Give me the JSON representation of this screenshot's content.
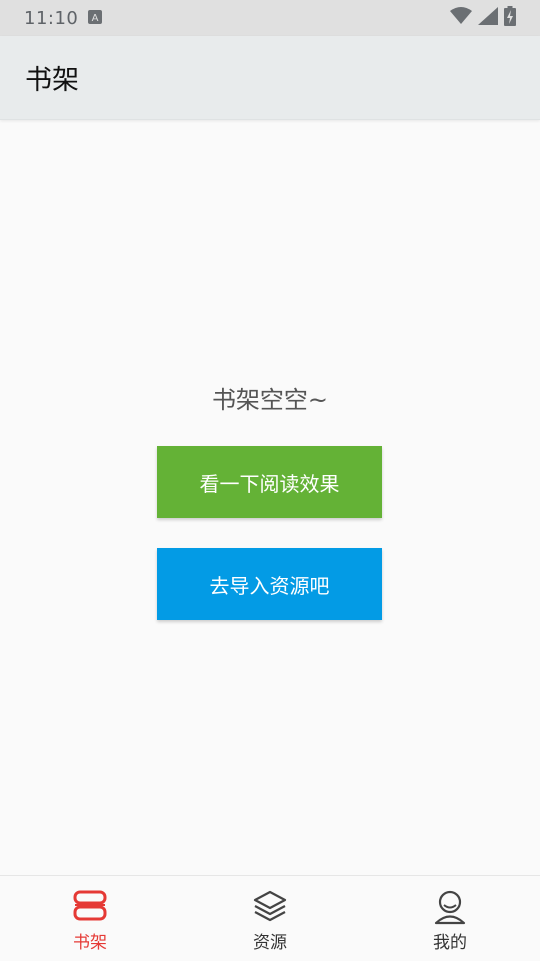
{
  "status_bar": {
    "time": "11:10",
    "notification_icon": "a-box-icon",
    "icons": [
      "wifi-icon",
      "signal-icon",
      "battery-charging-icon"
    ]
  },
  "app_bar": {
    "title": "书架"
  },
  "empty_state": {
    "message": "书架空空~",
    "demo_button_label": "看一下阅读效果",
    "import_button_label": "去导入资源吧"
  },
  "bottom_nav": {
    "items": [
      {
        "label": "书架",
        "icon": "bookshelf-icon",
        "active": true
      },
      {
        "label": "资源",
        "icon": "layers-icon",
        "active": false
      },
      {
        "label": "我的",
        "icon": "person-icon",
        "active": false
      }
    ]
  },
  "colors": {
    "accent_active": "#e53935",
    "demo_button": "#64b236",
    "import_button": "#039be5",
    "app_bar_bg": "#e8ebec"
  }
}
